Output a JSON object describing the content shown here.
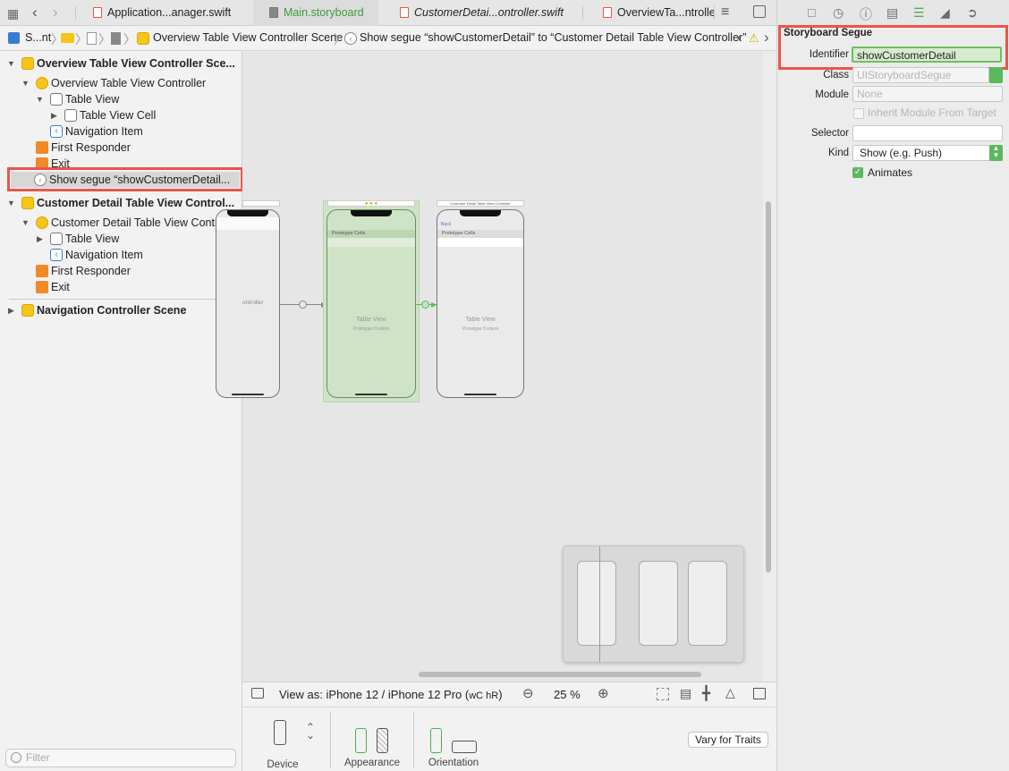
{
  "tabs": [
    {
      "label": "Application...anager.swift",
      "type": "swift"
    },
    {
      "label": "Main.storyboard",
      "type": "storyboard",
      "active": true
    },
    {
      "label": "CustomerDetai...ontroller.swift",
      "type": "swift"
    },
    {
      "label": "OverviewTa...ntroller",
      "type": "swift"
    }
  ],
  "jumpbar": {
    "project": "S...nt",
    "scene": "Overview Table View Controller Scene",
    "segue": "Show segue “showCustomerDetail” to “Customer Detail Table View Controller”"
  },
  "outline": {
    "scene1": "Overview Table View Controller Sce...",
    "vc1": "Overview Table View Controller",
    "table_view": "Table View",
    "table_view_cell": "Table View Cell",
    "nav_item": "Navigation Item",
    "first_responder": "First Responder",
    "exit": "Exit",
    "segue": "Show segue “showCustomerDetail...",
    "scene2": "Customer Detail Table View Control...",
    "vc2": "Customer Detail Table View Contr...",
    "table_view2": "Table View",
    "nav_item2": "Navigation Item",
    "first_responder2": "First Responder",
    "exit2": "Exit",
    "scene3": "Navigation Controller Scene",
    "filter_placeholder": "Filter"
  },
  "canvas": {
    "left_phone_text": "ontroller",
    "middle_phone": {
      "prototype": "Prototype Cells",
      "table": "Table View",
      "content": "Prototype Content"
    },
    "right_phone": {
      "header": "Customer Detail Table View Controller",
      "back": "Back",
      "prototype": "Prototype Cells",
      "table": "Table View",
      "content": "Prototype Content"
    }
  },
  "bottombar": {
    "view_as": "View as: iPhone 12 / iPhone 12 Pro (",
    "size_class": "wC hR",
    "view_as_end": ")",
    "zoom": "25 %"
  },
  "traits": {
    "device": "Device",
    "appearance": "Appearance",
    "orientation": "Orientation",
    "vary": "Vary for Traits"
  },
  "inspector": {
    "section": "Storyboard Segue",
    "identifier_label": "Identifier",
    "identifier_value": "showCustomerDetail",
    "class_label": "Class",
    "class_placeholder": "UIStoryboardSegue",
    "module_label": "Module",
    "module_value": "None",
    "inherit_label": "Inherit Module From Target",
    "selector_label": "Selector",
    "kind_label": "Kind",
    "kind_value": "Show (e.g. Push)",
    "animates_label": "Animates",
    "animates_checked": true
  },
  "colors": {
    "highlight": "#e8564a",
    "accent_green": "#3c9a3c",
    "selected_vc": "#cfe3c6"
  }
}
